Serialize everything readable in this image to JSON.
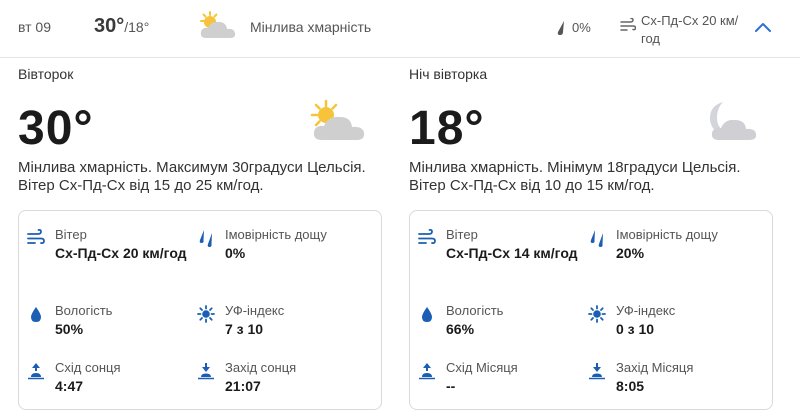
{
  "summary": {
    "day": "вт 09",
    "high": "30°",
    "low": "/18°",
    "condition": "Мінлива хмарність",
    "rain": "0%",
    "wind": "Сх-Пд-Сх 20 км/год"
  },
  "day": {
    "title": "Вівторок",
    "temp": "30°",
    "desc": "Мінлива хмарність. Максимум 30градуси Цельсія. Вітер Сх-Пд-Сх від 15 до 25 км/год.",
    "wind_label": "Вітер",
    "wind_value": "Сх-Пд-Сх 20 км/год",
    "rain_label": "Імовірність дощу",
    "rain_value": "0%",
    "humidity_label": "Вологість",
    "humidity_value": "50%",
    "uv_label": "УФ-індекс",
    "uv_value": "7 з 10",
    "rise_label": "Схід сонця",
    "rise_value": "4:47",
    "set_label": "Захід сонця",
    "set_value": "21:07"
  },
  "night": {
    "title": "Ніч вівторка",
    "temp": "18°",
    "desc": "Мінлива хмарність. Мінімум 18градуси Цельсія. Вітер Сх-Пд-Сх від 10 до 15 км/год.",
    "wind_label": "Вітер",
    "wind_value": "Сх-Пд-Сх 14 км/год",
    "rain_label": "Імовірність дощу",
    "rain_value": "20%",
    "humidity_label": "Вологість",
    "humidity_value": "66%",
    "uv_label": "УФ-індекс",
    "uv_value": "0 з 10",
    "rise_label": "Схід Місяця",
    "rise_value": "--",
    "set_label": "Захід Місяця",
    "set_value": "8:05"
  },
  "icons": {
    "summary_weather": "partly-cloudy-sun-icon",
    "day_weather": "partly-cloudy-sun-icon",
    "night_weather": "partly-cloudy-moon-icon",
    "wind": "wind-icon",
    "rain": "raindrops-icon",
    "humidity": "droplet-icon",
    "uv": "sun-uv-icon",
    "sunrise": "sunrise-icon",
    "sunset": "sunset-icon",
    "moonrise": "moonrise-icon",
    "moonset": "moonset-icon",
    "collapse": "chevron-up-icon"
  },
  "colors": {
    "icon_blue": "#1a5fb4",
    "sun_yellow": "#f6c43b",
    "cloud_gray": "#c8c8c8",
    "moon_gray": "#d4d4dc",
    "chevron_blue": "#2d6fd3"
  }
}
